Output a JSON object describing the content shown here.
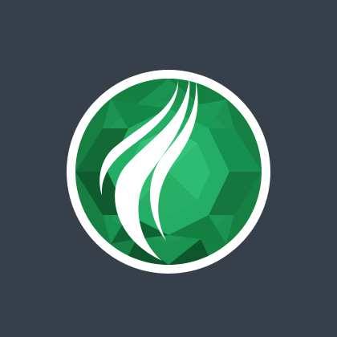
{
  "logo": {
    "icon": "green-gem-flame-logo",
    "colors": {
      "background": "#373f4a",
      "ring": "#ffffff",
      "gem_dark": "#0f5a2e",
      "gem_mid": "#178a48",
      "gem_light": "#2bb673",
      "swoosh": "#ffffff"
    }
  }
}
